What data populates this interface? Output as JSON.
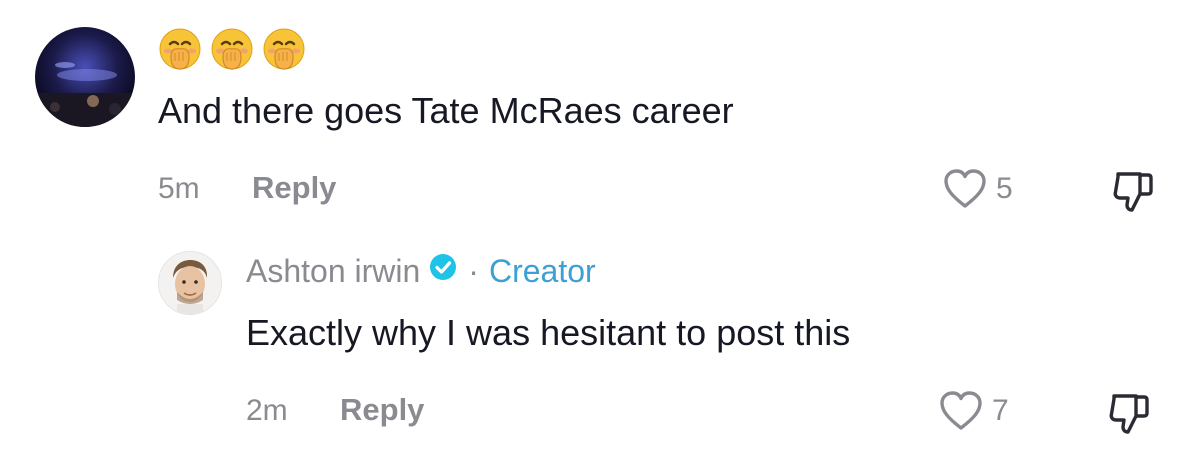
{
  "comments": [
    {
      "emoji_line": "🤭🤭🤭",
      "text": "And there goes Tate McRaes career",
      "time": "5m",
      "reply_label": "Reply",
      "likes": "5"
    }
  ],
  "reply": {
    "author": "Ashton irwin",
    "separator": "·",
    "role": "Creator",
    "text": "Exactly why I was hesitant to post this",
    "time": "2m",
    "reply_label": "Reply",
    "likes": "7"
  },
  "colors": {
    "text": "#161823",
    "muted": "#8a8b91",
    "creator": "#3d9fd4",
    "verified": "#20c3e8"
  },
  "icons": [
    "heart-outline-icon",
    "thumbs-down-icon",
    "verified-badge-icon"
  ]
}
